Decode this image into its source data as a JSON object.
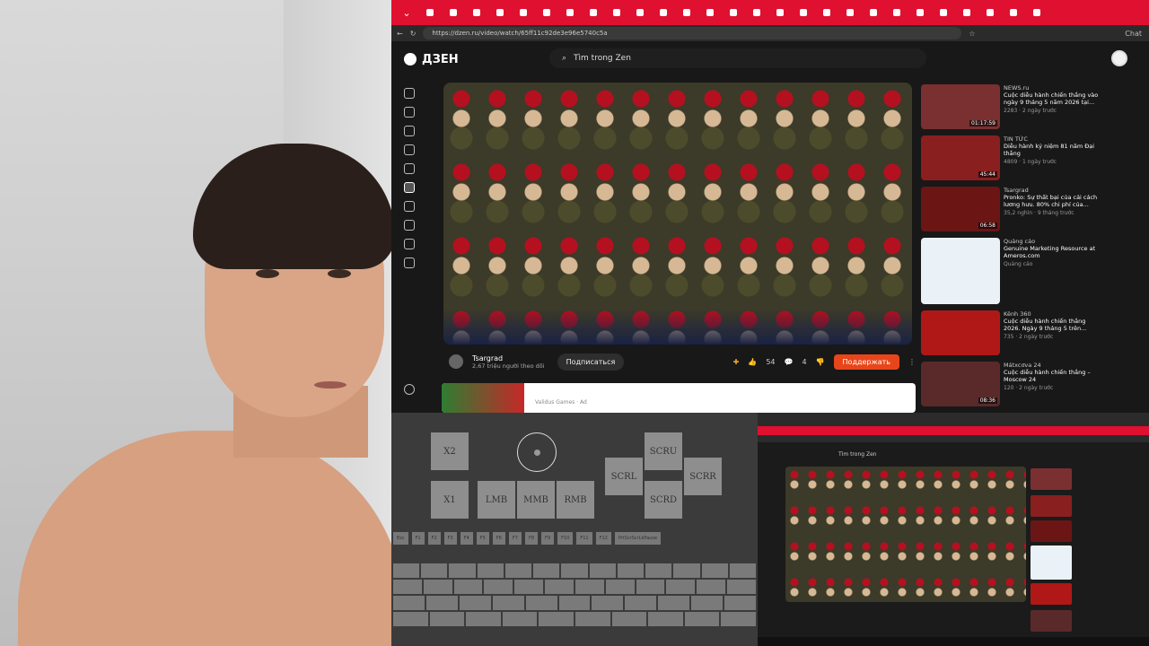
{
  "browser": {
    "url": "https://dzen.ru/video/watch/65ff11c92de3e96e5740c5a",
    "chat_label": "Chat",
    "tab_count": 27
  },
  "zen": {
    "logo": "ДЗЕН",
    "search_placeholder": "Tìm trong Zen"
  },
  "video": {
    "channel": "Tsargrad",
    "subscribers": "2,67 triệu người theo dõi",
    "subscribe_label": "Подписаться",
    "likes": "54",
    "comments": "4",
    "support_label": "Поддержать"
  },
  "next_card": {
    "text": "Validus Games · Ad"
  },
  "recommendations": [
    {
      "source": "NEWS.ru",
      "title": "Cuộc diễu hành chiến thắng vào ngày 9 tháng 5 năm 2026 tại...",
      "stats": "2283 · 2 ngày trước",
      "duration": "01:17:59",
      "color": "#7a3030"
    },
    {
      "source": "TIN TỨC",
      "title": "Diễu hành kỷ niệm 81 năm Đại thắng",
      "stats": "4809 · 1 ngày trước",
      "duration": "45:44",
      "color": "#8a1f1f"
    },
    {
      "source": "Tsargrad",
      "title": "Pronko: Sự thất bại của cải cách lương hưu. 80% chi phí của...",
      "stats": "35,2 nghìn · 9 tháng trước",
      "duration": "06:58",
      "color": "#6b1515"
    },
    {
      "source": "Quảng cáo",
      "title": "Genuine Marketing Resource at Ameros.com",
      "stats": "Quảng cáo",
      "duration": "",
      "color": "#eaf2f8"
    },
    {
      "source": "Kênh 360",
      "title": "Cuộc diễu hành chiến thắng 2026. Ngày 9 tháng 5 trên...",
      "stats": "735 · 2 ngày trước",
      "duration": "",
      "color": "#b01818"
    },
    {
      "source": "Mátxcơva 24",
      "title": "Cuộc diễu hành chiến thắng – Moscow 24",
      "stats": "120 · 2 ngày trước",
      "duration": "08:36",
      "color": "#5a2a2a"
    }
  ],
  "vpad": {
    "x2": "X2",
    "x1": "X1",
    "lmb": "LMB",
    "mmb": "MMB",
    "rmb": "RMB",
    "scru": "SCRU",
    "scrl": "SCRL",
    "scrr": "SCRR",
    "scrd": "SCRD",
    "fkeys": [
      "Esc",
      "F1",
      "F2",
      "F3",
      "F4",
      "F5",
      "F6",
      "F7",
      "F8",
      "F9",
      "F10",
      "F11",
      "F12",
      "PrtScrScrLkPause"
    ]
  },
  "mini": {
    "search": "Tìm trong Zen"
  }
}
